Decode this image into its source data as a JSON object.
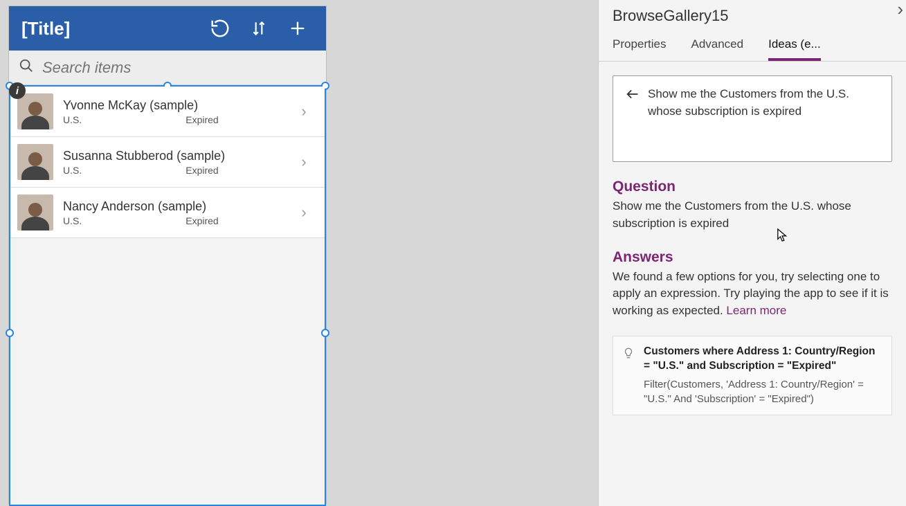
{
  "phone": {
    "title": "[Title]",
    "search_placeholder": "Search items",
    "items": [
      {
        "name": "Yvonne McKay (sample)",
        "country": "U.S.",
        "status": "Expired"
      },
      {
        "name": "Susanna Stubberod (sample)",
        "country": "U.S.",
        "status": "Expired"
      },
      {
        "name": "Nancy Anderson (sample)",
        "country": "U.S.",
        "status": "Expired"
      }
    ]
  },
  "panel": {
    "control_name": "BrowseGallery15",
    "tabs": {
      "properties": "Properties",
      "advanced": "Advanced",
      "ideas": "Ideas (e..."
    },
    "query_text": "Show me the Customers from the U.S. whose subscription is expired",
    "question_heading": "Question",
    "question_text": "Show me the Customers from the U.S. whose subscription is expired",
    "answers_heading": "Answers",
    "answers_text": "We found a few options for you, try selecting one to apply an expression. Try playing the app to see if it is working as expected. ",
    "learn_more": "Learn more",
    "suggestion_desc": "Customers where Address 1: Country/Region = \"U.S.\" and Subscription = \"Expired\"",
    "suggestion_code": "Filter(Customers, 'Address 1: Country/Region' = \"U.S.\" And 'Subscription' = \"Expired\")"
  }
}
